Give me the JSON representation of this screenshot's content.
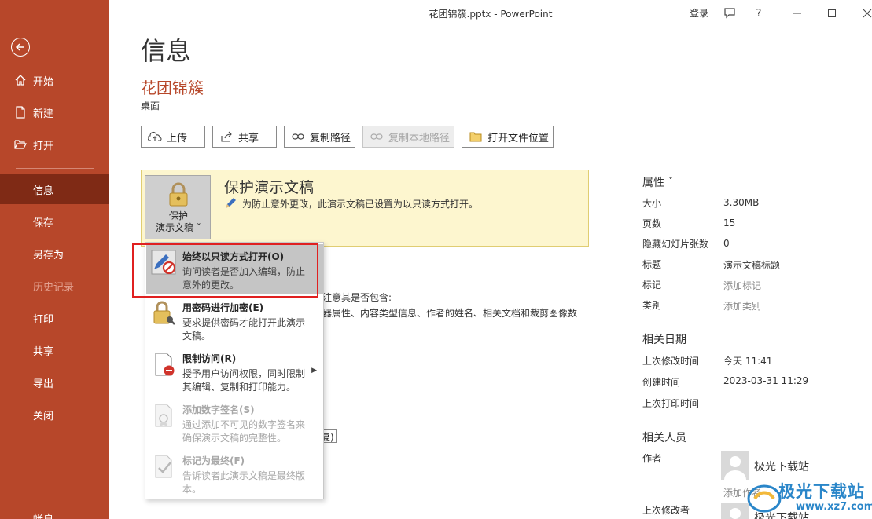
{
  "window": {
    "title": "花团锦簇.pptx  -  PowerPoint",
    "login_label": "登录",
    "help_label": "?"
  },
  "sidebar": {
    "items": [
      {
        "label": "开始",
        "icon": "home-icon"
      },
      {
        "label": "新建",
        "icon": "new-file-icon"
      },
      {
        "label": "打开",
        "icon": "folder-open-icon"
      },
      {
        "label": "信息"
      },
      {
        "label": "保存"
      },
      {
        "label": "另存为"
      },
      {
        "label": "历史记录"
      },
      {
        "label": "打印"
      },
      {
        "label": "共享"
      },
      {
        "label": "导出"
      },
      {
        "label": "关闭"
      },
      {
        "label": "帐户"
      }
    ],
    "active": "信息"
  },
  "main": {
    "page_title": "信息",
    "file_name": "花团锦簇",
    "file_location": "桌面",
    "actions": [
      {
        "label": "上传",
        "icon": "cloud-upload-icon"
      },
      {
        "label": "共享",
        "icon": "share-icon"
      },
      {
        "label": "复制路径",
        "icon": "link-icon"
      },
      {
        "label": "复制本地路径",
        "icon": "link-icon"
      },
      {
        "label": "打开文件位置",
        "icon": "folder-icon"
      }
    ],
    "protect": {
      "button_line1": "保护",
      "button_line2": "演示文稿 ˇ",
      "heading": "保护演示文稿",
      "description": "为防止意外更改，此演示文稿已设置为以只读方式打开。"
    },
    "background_text": {
      "line1": "注意其是否包含:",
      "line2": "器属性、内容类型信息、作者的姓名、相关文档和裁剪图像数",
      "box_text": "复)"
    }
  },
  "dropdown": {
    "items": [
      {
        "title": "始终以只读方式打开(O)",
        "desc1": "询问读者是否加入编辑，防止",
        "desc2": "意外的更改。"
      },
      {
        "title": "用密码进行加密(E)",
        "desc1": "要求提供密码才能打开此演示",
        "desc2": "文稿。"
      },
      {
        "title": "限制访问(R)",
        "desc1": "授予用户访问权限，同时限制",
        "desc2": "其编辑、复制和打印能力。"
      },
      {
        "title": "添加数字签名(S)",
        "desc1": "通过添加不可见的数字签名来",
        "desc2": "确保演示文稿的完整性。"
      },
      {
        "title": "标记为最终(F)",
        "desc1": "告诉读者此演示文稿是最终版",
        "desc2": "本。"
      }
    ]
  },
  "properties": {
    "heading": "属性 ˇ",
    "rows": [
      {
        "key": "大小",
        "value": "3.30MB"
      },
      {
        "key": "页数",
        "value": "15"
      },
      {
        "key": "隐藏幻灯片张数",
        "value": "0"
      },
      {
        "key": "标题",
        "value": "演示文稿标题"
      },
      {
        "key": "标记",
        "value": "添加标记"
      },
      {
        "key": "类别",
        "value": "添加类别"
      }
    ],
    "dates_heading": "相关日期",
    "dates": [
      {
        "key": "上次修改时间",
        "value": "今天 11:41"
      },
      {
        "key": "创建时间",
        "value": "2023-03-31 11:29"
      },
      {
        "key": "上次打印时间",
        "value": ""
      }
    ],
    "people_heading": "相关人员",
    "author_label": "作者",
    "author_name": "极光下载站",
    "add_author": "添加作者",
    "last_modified_by_label": "上次修改者",
    "last_modified_by_name": "极光下载站"
  },
  "watermark": {
    "text": "极光下载站",
    "url": "www.xz7.com"
  }
}
